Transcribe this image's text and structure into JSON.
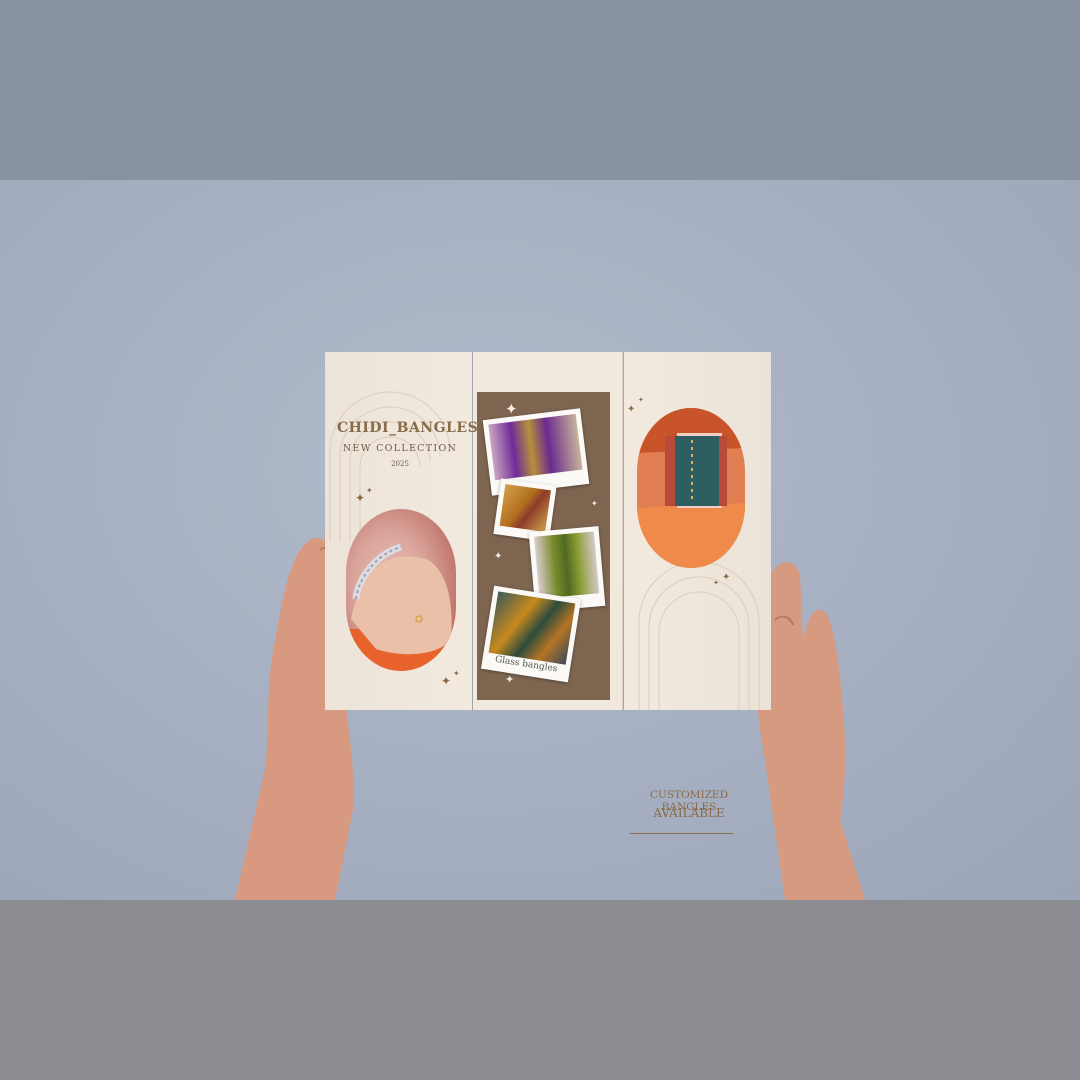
{
  "brochure": {
    "brand": "CHIDI_BANGLES",
    "subtitle": "NEW COLLECTION",
    "year": "2025",
    "polaroid_caption": "Glass bangles",
    "right_line1": "CUSTOMIZED BANGLES",
    "right_line2": "AVAILABLE"
  },
  "colors": {
    "backdrop": "#a7b1c3",
    "paper": "#efe6dc",
    "brown_panel": "#7d6550",
    "accent_text": "#8a6b48"
  },
  "icons": {
    "sparkle": "✦"
  }
}
